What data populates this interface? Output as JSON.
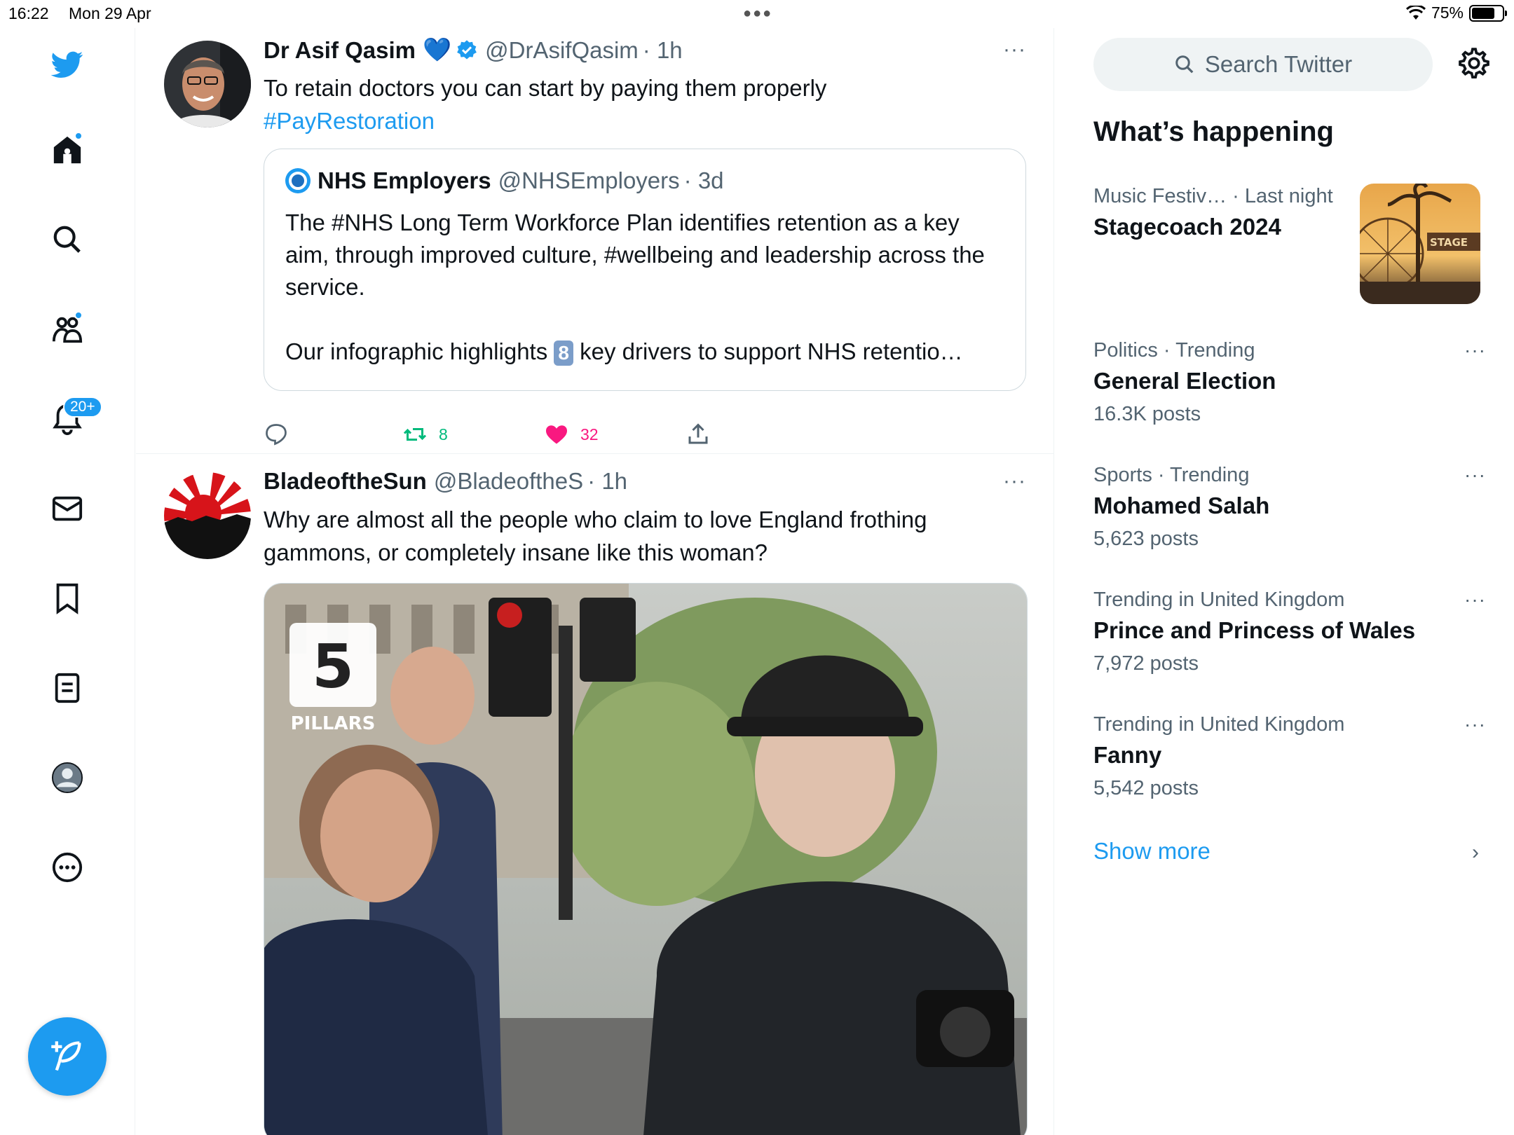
{
  "status_bar": {
    "time": "16:22",
    "date": "Mon 29 Apr",
    "battery": "75%",
    "battery_level": 0.75
  },
  "nav": {
    "items": [
      {
        "name": "home-icon",
        "has_dot": true
      },
      {
        "name": "search-icon"
      },
      {
        "name": "communities-icon",
        "has_dot": true
      },
      {
        "name": "notifications-icon",
        "badge": "20+"
      },
      {
        "name": "messages-icon"
      },
      {
        "name": "bookmarks-icon"
      },
      {
        "name": "lists-icon"
      },
      {
        "name": "profile-icon"
      },
      {
        "name": "more-icon"
      }
    ],
    "compose_icon": "feather-plus-icon"
  },
  "timeline": {
    "tweets": [
      {
        "name": "Dr Asif Qasim",
        "emoji": "💙",
        "handle": "@DrAsifQasim",
        "time": "· 1h",
        "text": "To retain doctors you can start by paying them properly",
        "hashtag": "#PayRestoration",
        "quote": {
          "name": "NHS Employers",
          "handle": "@NHSEmployers",
          "time": "· 3d",
          "text_line1": "The #NHS Long Term Workforce Plan identifies retention as a key aim, through improved culture, #wellbeing and leadership across the service.",
          "text_line2_pre": "Our infographic highlights",
          "keycap": "8",
          "text_line2_post": "key drivers to support NHS retentio…"
        },
        "retweets": "8",
        "likes": "32"
      },
      {
        "name": "BladeoftheSun",
        "handle": "@BladeoftheS",
        "time": "· 1h",
        "text": "Why are almost all the people who claim to love England frothing gammons, or completely insane like this woman?",
        "media_overlay_number": "5",
        "media_overlay_label": "PILLARS"
      }
    ],
    "more_label": "···"
  },
  "sidebar": {
    "search_placeholder": "Search Twitter",
    "title": "What’s happening",
    "trends": [
      {
        "meta": "Music Festiv… · Last night",
        "title": "Stagecoach 2024",
        "thumb_text": "STAGE"
      },
      {
        "meta": "Politics · Trending",
        "title": "General Election",
        "count": "16.3K posts"
      },
      {
        "meta": "Sports · Trending",
        "title": "Mohamed Salah",
        "count": "5,623 posts"
      },
      {
        "meta": "Trending in United Kingdom",
        "title": "Prince and Princess of Wales",
        "count": "7,972 posts"
      },
      {
        "meta": "Trending in United Kingdom",
        "title": "Fanny",
        "count": "5,542 posts"
      }
    ],
    "show_more": "Show more",
    "chevron": "›"
  },
  "colors": {
    "accent": "#1d9bf0",
    "like": "#f91880",
    "retweet": "#00ba7c",
    "secondary_text": "#536471"
  }
}
